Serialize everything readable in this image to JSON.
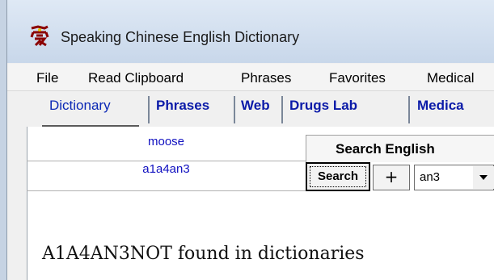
{
  "window": {
    "title": "Speaking Chinese English Dictionary",
    "icon": "love-character-icon"
  },
  "menu": {
    "items": [
      "File",
      "Read Clipboard",
      "Phrases",
      "Favorites",
      "Medical"
    ]
  },
  "tabs": [
    {
      "label": "Dictionary",
      "selected": true
    },
    {
      "label": "Phrases",
      "selected": false
    },
    {
      "label": "Web",
      "selected": false
    },
    {
      "label": "Drugs Lab",
      "selected": false
    },
    {
      "label": "Medica",
      "selected": false
    }
  ],
  "search": {
    "word_value": "moose",
    "pinyin_value": "a1a4an3",
    "search_english_label": "Search English",
    "search_button_label": "Search",
    "plus_button_label": "+",
    "tone_select_value": "an3"
  },
  "result": {
    "message": "A1A4AN3NOT found in dictionaries"
  },
  "colors": {
    "link_blue": "#0a1aa8",
    "field_text_blue": "#1010c0",
    "title_bar": "#c8d7ea"
  }
}
